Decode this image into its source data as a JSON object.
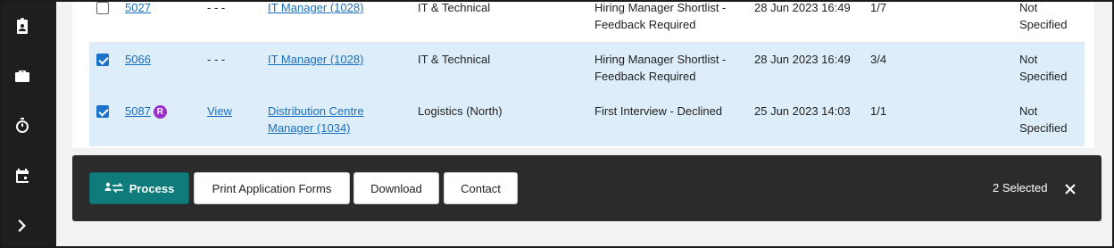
{
  "sidebar": {
    "items": [
      {
        "icon": "clipboard-person-icon"
      },
      {
        "icon": "briefcase-icon"
      },
      {
        "icon": "stopwatch-icon"
      },
      {
        "icon": "calendar-icon"
      },
      {
        "icon": "chevron-right-icon"
      }
    ]
  },
  "table": {
    "rows": [
      {
        "checked": false,
        "id": "5027",
        "badge": "",
        "view": "- - -",
        "job": "IT Manager (1028)",
        "department": "IT & Technical",
        "status": "Hiring Manager Shortlist - Feedback Required",
        "date": "28 Jun 2023 16:49",
        "position": "1/7",
        "extra": "Not Specified"
      },
      {
        "checked": true,
        "id": "5066",
        "badge": "",
        "view": "- - -",
        "job": "IT Manager (1028)",
        "department": "IT & Technical",
        "status": "Hiring Manager Shortlist - Feedback Required",
        "date": "28 Jun 2023 16:49",
        "position": "3/4",
        "extra": "Not Specified"
      },
      {
        "checked": true,
        "id": "5087",
        "badge": "R",
        "view": "View",
        "job": "Distribution Centre Manager (1034)",
        "department": "Logistics (North)",
        "status": "First Interview - Declined",
        "date": "25 Jun 2023 14:03",
        "position": "1/1",
        "extra": "Not Specified"
      }
    ]
  },
  "actionbar": {
    "process_label": "Process",
    "print_label": "Print Application Forms",
    "download_label": "Download",
    "contact_label": "Contact",
    "selected_text": "2 Selected"
  },
  "colors": {
    "sidebar": "#1e1e1e",
    "primary": "#0f7b7b",
    "selected_row": "#ddeefa",
    "link": "#1a6fbf",
    "badge": "#9b2fc9"
  }
}
